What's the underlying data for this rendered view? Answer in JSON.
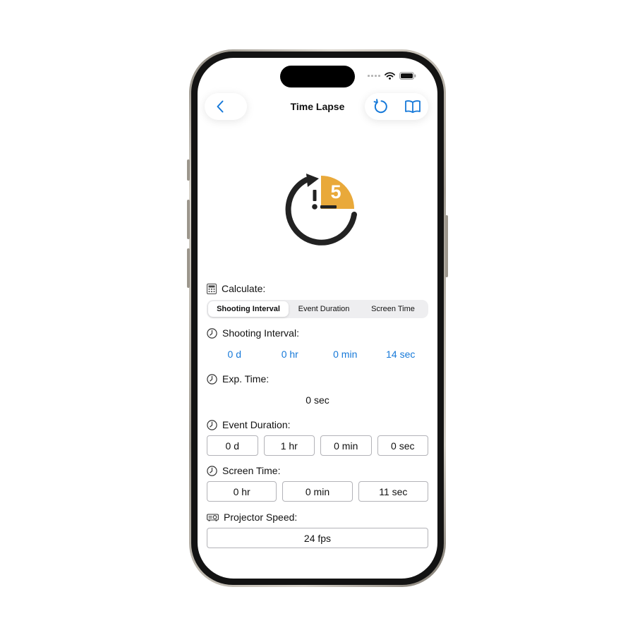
{
  "app": {
    "title": "Time Lapse"
  },
  "nav": {
    "back_icon": "chevron-left-icon",
    "refresh_icon": "refresh-icon",
    "guide_icon": "book-icon"
  },
  "colors": {
    "accent": "#1679d9",
    "hero_dark": "#222222",
    "hero_badge": "#e9a93a",
    "text": "#111111",
    "segment_track": "#eeeef0"
  },
  "hero": {
    "badge_number": "5"
  },
  "calculate": {
    "label": "Calculate:",
    "icon": "calculator-icon",
    "options": [
      "Shooting Interval",
      "Event Duration",
      "Screen Time"
    ],
    "selected": "Shooting Interval"
  },
  "shooting_interval": {
    "label": "Shooting Interval:",
    "icon": "clock-icon",
    "values": [
      "0 d",
      "0 hr",
      "0 min",
      "14 sec"
    ]
  },
  "exp_time": {
    "label": "Exp. Time:",
    "icon": "clock-icon",
    "value": "0 sec"
  },
  "event_duration": {
    "label": "Event Duration:",
    "icon": "clock-icon",
    "values": [
      "0 d",
      "1 hr",
      "0 min",
      "0 sec"
    ]
  },
  "screen_time": {
    "label": "Screen Time:",
    "icon": "clock-icon",
    "values": [
      "0 hr",
      "0 min",
      "11 sec"
    ]
  },
  "projector_speed": {
    "label": "Projector Speed:",
    "icon": "projector-icon",
    "value": "24 fps"
  }
}
